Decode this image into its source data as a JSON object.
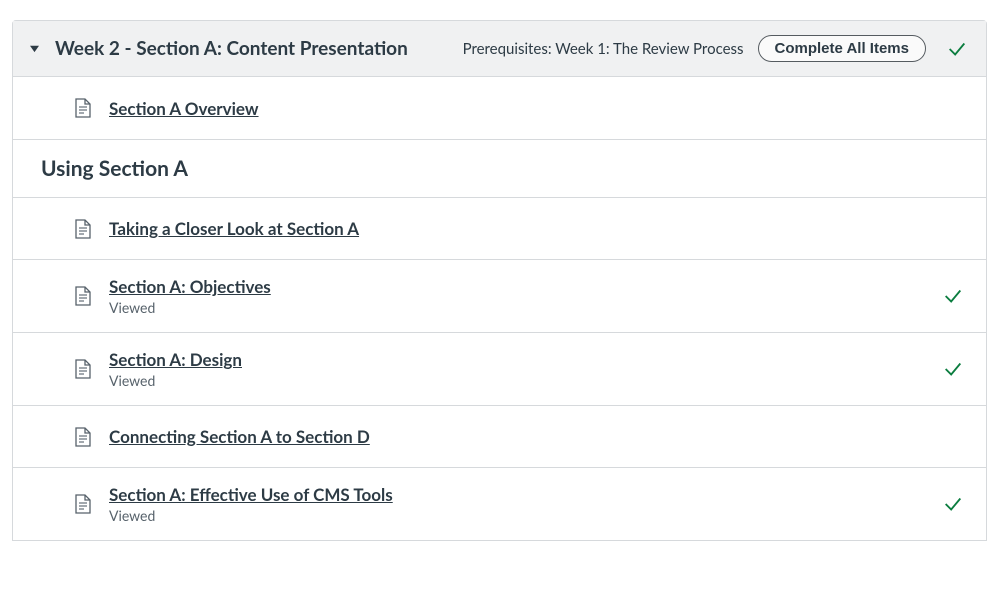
{
  "module": {
    "title": "Week 2 - Section A: Content Presentation",
    "prerequisites": "Prerequisites: Week 1: The Review Process",
    "complete_all_label": "Complete All Items",
    "header_completed": true
  },
  "items": [
    {
      "kind": "page",
      "title": "Section A Overview",
      "status": null,
      "completed": false
    },
    {
      "kind": "subheader",
      "title": "Using Section A"
    },
    {
      "kind": "page",
      "title": "Taking a Closer Look at Section A",
      "status": null,
      "completed": false
    },
    {
      "kind": "page",
      "title": "Section A: Objectives",
      "status": "Viewed",
      "completed": true
    },
    {
      "kind": "page",
      "title": "Section A: Design",
      "status": "Viewed",
      "completed": true
    },
    {
      "kind": "page",
      "title": "Connecting Section A to Section D",
      "status": null,
      "completed": false
    },
    {
      "kind": "page",
      "title": "Section A: Effective Use of CMS Tools",
      "status": "Viewed",
      "completed": true
    }
  ]
}
